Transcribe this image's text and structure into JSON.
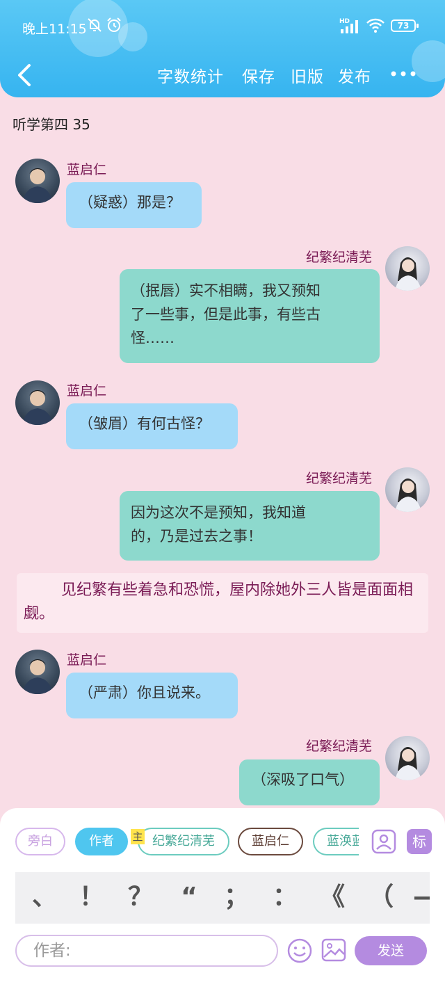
{
  "status_bar": {
    "time": "晚上11:15",
    "battery": "73",
    "network": "HD"
  },
  "header": {
    "actions": [
      "字数统计",
      "保存",
      "旧版",
      "发布"
    ]
  },
  "chapter": {
    "title": "听学第四 35"
  },
  "messages": [
    {
      "sender": "蓝启仁",
      "text": "（疑惑）那是？"
    },
    {
      "sender": "纪繁纪清芜",
      "lines": [
        "（抿唇）实不相瞒，我又预知",
        "了一些事，但是此事，有些古",
        "怪……"
      ]
    },
    {
      "sender": "蓝启仁",
      "text": "（皱眉）有何古怪？"
    },
    {
      "sender": "纪繁纪清芜",
      "lines": [
        "因为这次不是预知，我知道",
        "的，乃是过去之事！"
      ]
    },
    {
      "sender": "蓝启仁",
      "text": "（严肃）你且说来。"
    },
    {
      "sender": "纪繁纪清芜",
      "text": "（深吸了口气）"
    }
  ],
  "narration": {
    "text": "见纪繁有些着急和恐慌，屋内除她外三人皆是面面相觑。"
  },
  "roles": {
    "pangbai": "旁白",
    "zuozhe": "作者",
    "main_tag": "主",
    "ji": "纪繁纪清芜",
    "lan": "蓝启仁",
    "lanhuan": "蓝涣蓝"
  },
  "toolbar": {
    "biao": "标"
  },
  "punctuation": [
    "、",
    "！",
    "？",
    "“",
    "；",
    "：",
    "《",
    "（",
    "—"
  ],
  "composer": {
    "placeholder": "作者:",
    "send": "发送"
  },
  "colors": {
    "header": "#36b4f0",
    "background": "#f9dde6",
    "left_bubble": "#a4daf9",
    "right_bubble": "#8dd9cd",
    "sender_name": "#7a1b55",
    "send_button": "#b48be0"
  }
}
